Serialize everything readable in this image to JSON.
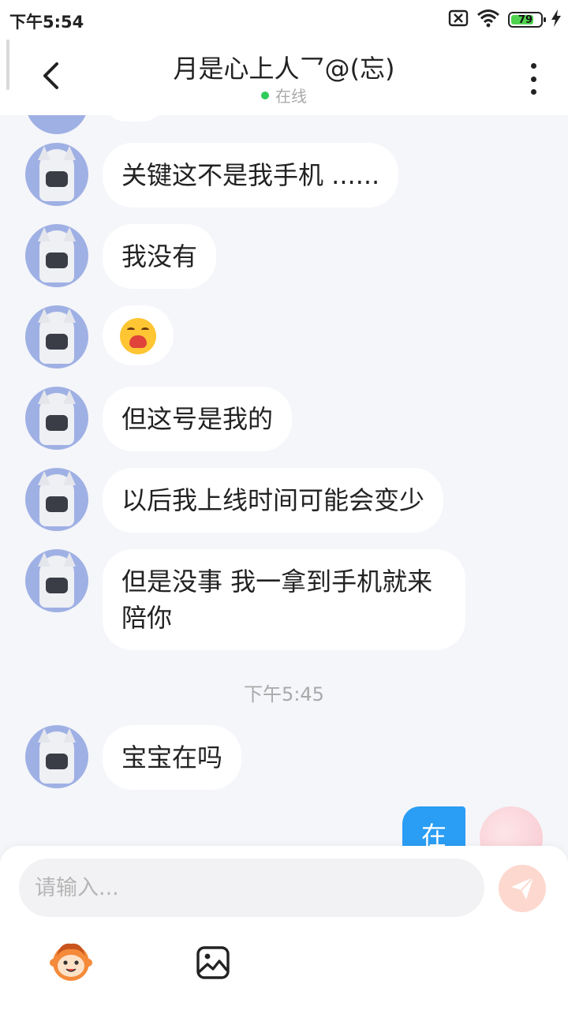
{
  "status_bar": {
    "time": "下午5:54",
    "battery": "79",
    "battery_level": 0.79,
    "icons": [
      "sim-missing-icon",
      "wifi-icon",
      "battery-icon",
      "charging-icon"
    ]
  },
  "header": {
    "title": "月是心上人乛@(忘)",
    "status": "在线",
    "icons": [
      "back-icon",
      "more-vertical-icon"
    ],
    "online_color": "#2ecc5a"
  },
  "messages": [
    {
      "sender": "other",
      "text": "关键这不是我手机 ......"
    },
    {
      "sender": "other",
      "text": "我没有"
    },
    {
      "sender": "other",
      "emoji": "crying-laughing-emoji"
    },
    {
      "sender": "other",
      "text": "但这号是我的"
    },
    {
      "sender": "other",
      "text": "以后我上线时间可能会变少"
    },
    {
      "sender": "other",
      "text": "但是没事 我一拿到手机就来陪你"
    },
    {
      "divider": "下午5:45"
    },
    {
      "sender": "other",
      "text": "宝宝在吗"
    },
    {
      "sender": "self",
      "text": "在"
    }
  ],
  "input": {
    "placeholder": "请输入...",
    "value": ""
  },
  "toolbar": {
    "items": [
      "emoji-sticker-icon",
      "image-icon"
    ]
  },
  "colors": {
    "background": "#f5f6fa",
    "own_bubble": "#2a9df4",
    "send_button": "#fdd8cf"
  }
}
